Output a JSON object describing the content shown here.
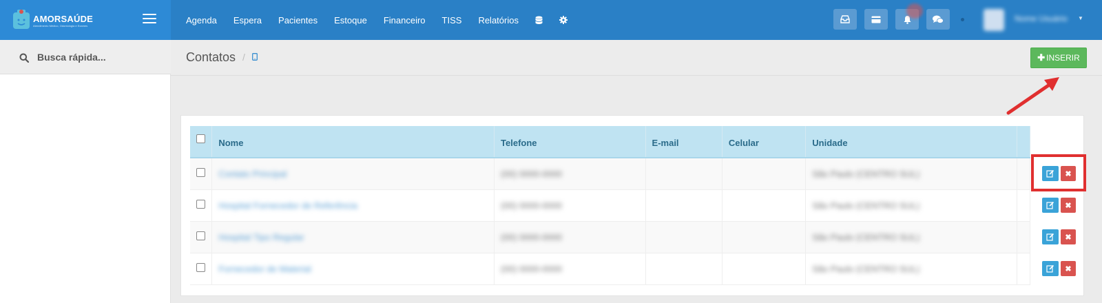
{
  "brand": {
    "name": "AMORSAÚDE",
    "tagline": "Atendimento Médico, Odontologia e Exames"
  },
  "nav": {
    "items": [
      "Agenda",
      "Espera",
      "Pacientes",
      "Estoque",
      "Financeiro",
      "TISS",
      "Relatórios"
    ],
    "icons": [
      "database-icon",
      "gear-icon"
    ]
  },
  "topbar": {
    "buttons": [
      "inbox-icon",
      "card-icon",
      "bell-icon",
      "chat-icon"
    ],
    "username": "Nome Usuário"
  },
  "search": {
    "placeholder": "Busca rápida..."
  },
  "page": {
    "title": "Contatos",
    "separator": "/"
  },
  "insert_button": {
    "label": "INSERIR",
    "icon": "plus-icon"
  },
  "table": {
    "columns": [
      "Nome",
      "Telefone",
      "E-mail",
      "Celular",
      "Unidade"
    ],
    "rows": [
      {
        "nome": "Contato Principal",
        "telefone": "(00) 0000-0000",
        "email": "",
        "celular": "",
        "unidade": "São Paulo (CENTRO SUL)"
      },
      {
        "nome": "Hospital Fornecedor de Referência",
        "telefone": "(00) 0000-0000",
        "email": "",
        "celular": "",
        "unidade": "São Paulo (CENTRO SUL)"
      },
      {
        "nome": "Hospital Tipo Regular",
        "telefone": "(00) 0000-0000",
        "email": "",
        "celular": "",
        "unidade": "São Paulo (CENTRO SUL)"
      },
      {
        "nome": "Fornecedor de Material",
        "telefone": "(00) 0000-0000",
        "email": "",
        "celular": "",
        "unidade": "São Paulo (CENTRO SUL)"
      }
    ]
  },
  "colors": {
    "topbar": "#2a80c6",
    "brand": "#2d8ad6",
    "table_header": "#bfe3f2",
    "insert": "#5cb85c",
    "edit": "#3aa3d8",
    "delete": "#d9534f",
    "highlight": "#e02f2f"
  }
}
